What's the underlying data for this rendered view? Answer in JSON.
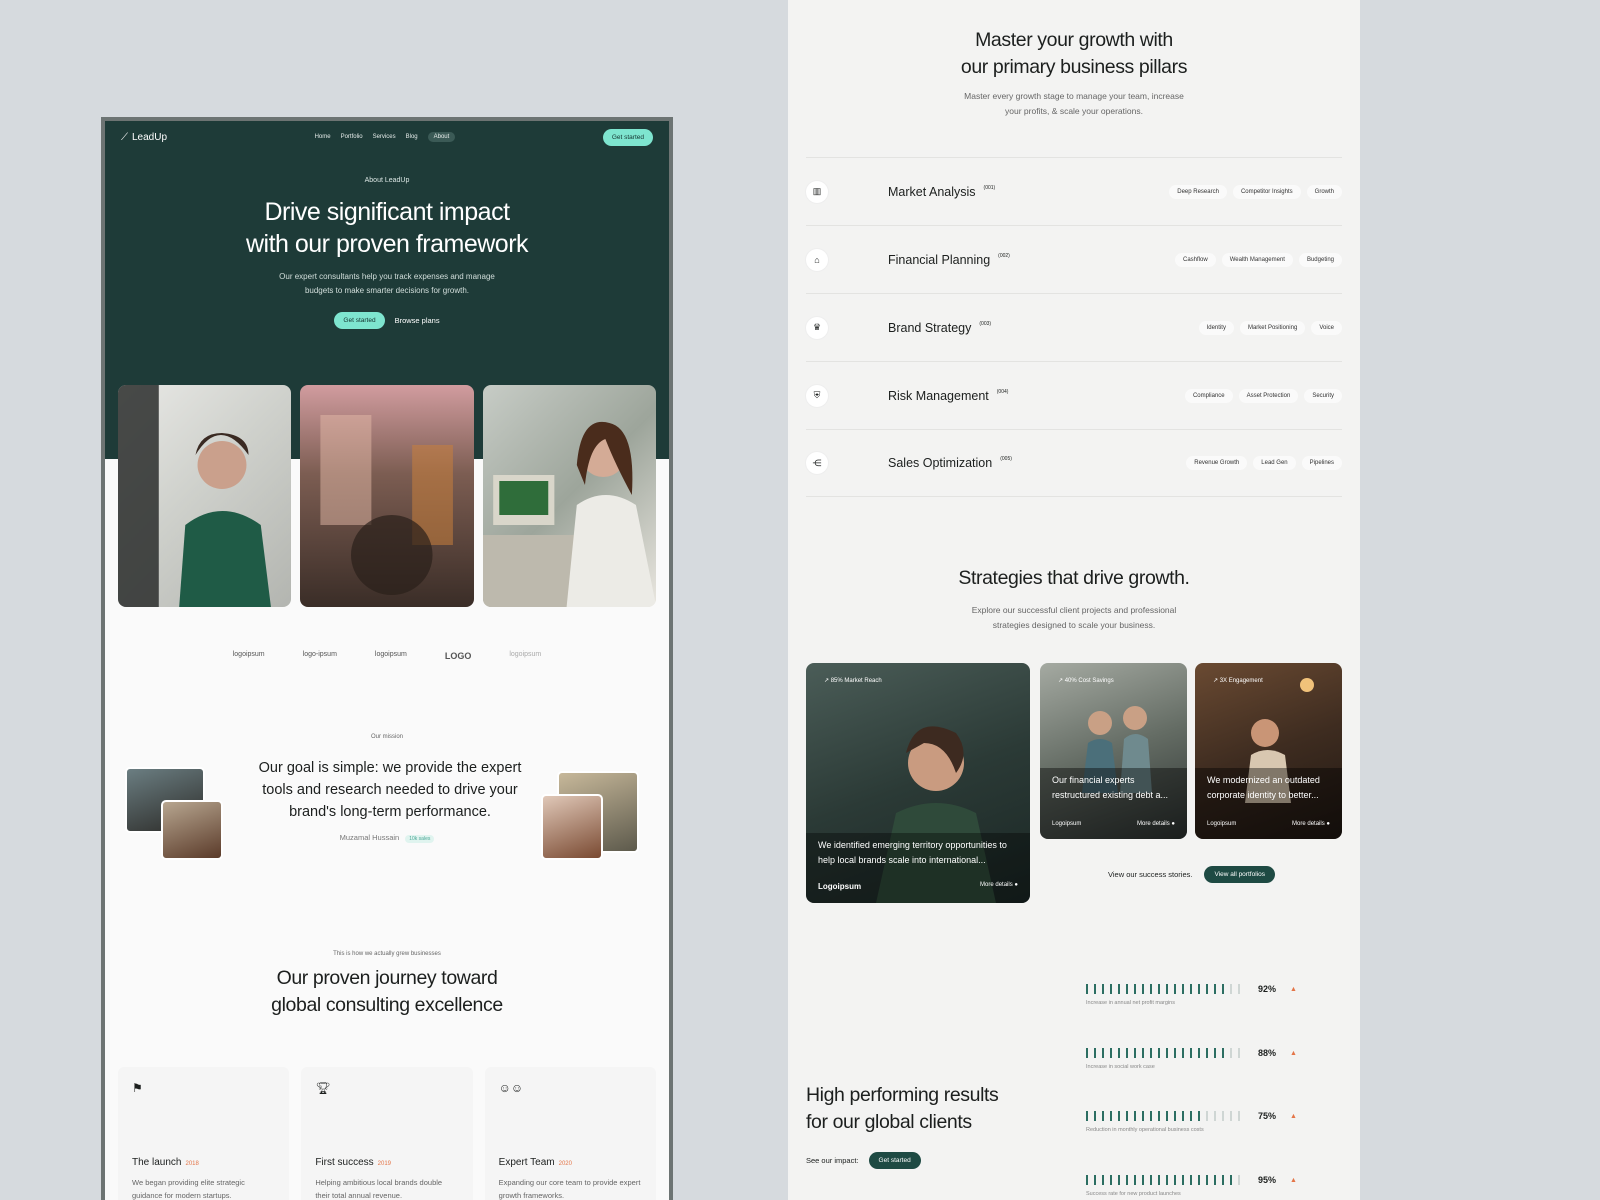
{
  "left": {
    "nav": {
      "logo": "LeadUp",
      "links": [
        "Home",
        "Portfolio",
        "Services",
        "Blog",
        "About"
      ],
      "cta": "Get started"
    },
    "hero": {
      "eyebrow": "About LeadUp",
      "title_line1": "Drive significant impact",
      "title_line2": "with our proven framework",
      "subtitle": "Our expert consultants help you track expenses and manage budgets to make smarter decisions for growth.",
      "primary_cta": "Get started",
      "secondary_cta": "Browse plans"
    },
    "logos": [
      "logoipsum",
      "logo-ipsum",
      "logoipsum",
      "LOGO",
      "logoipsum"
    ],
    "mission": {
      "eyebrow": "Our mission",
      "quote": "Our goal is simple: we provide the expert tools and research needed to drive your brand's long-term performance.",
      "author": "Muzamal Hussain",
      "author_tag": "10k sales"
    },
    "journey": {
      "eyebrow": "This is how we actually grew businesses",
      "title_line1": "Our proven journey toward",
      "title_line2": "global consulting excellence"
    },
    "milestones": [
      {
        "icon": "flag-icon",
        "title": "The launch",
        "year": "2018",
        "desc": "We began providing elite strategic guidance for modern startups."
      },
      {
        "icon": "trophy-icon",
        "title": "First success",
        "year": "2019",
        "desc": "Helping ambitious local brands double their total annual revenue."
      },
      {
        "icon": "team-icon",
        "title": "Expert Team",
        "year": "2020",
        "desc": "Expanding our core team to provide expert growth frameworks."
      }
    ]
  },
  "right": {
    "pillars_title_line1": "Master your growth with",
    "pillars_title_line2": "our primary business pillars",
    "pillars_subtitle": "Master every growth stage to manage your team, increase your profits, & scale your operations.",
    "pillars": [
      {
        "name": "Market Analysis",
        "num": "(001)",
        "tags": [
          "Deep Research",
          "Competitor Insights",
          "Growth"
        ]
      },
      {
        "name": "Financial Planning",
        "num": "(002)",
        "tags": [
          "Cashflow",
          "Wealth Management",
          "Budgeting"
        ]
      },
      {
        "name": "Brand Strategy",
        "num": "(003)",
        "tags": [
          "Identity",
          "Market Positioning",
          "Voice"
        ]
      },
      {
        "name": "Risk Management",
        "num": "(004)",
        "tags": [
          "Compliance",
          "Asset Protection",
          "Security"
        ]
      },
      {
        "name": "Sales Optimization",
        "num": "(005)",
        "tags": [
          "Revenue Growth",
          "Lead Gen",
          "Pipelines"
        ]
      }
    ],
    "strategies_title": "Strategies that drive growth.",
    "strategies_subtitle": "Explore our successful client projects and professional strategies designed to scale your business.",
    "projects": [
      {
        "badge": "85% Market Reach",
        "desc": "We identified emerging territory opportunities to help local brands scale into international...",
        "brand": "Logoipsum",
        "more": "More details"
      },
      {
        "badge": "40% Cost Savings",
        "desc": "Our financial experts restructured existing debt a...",
        "brand": "Logoipsum",
        "more": "More details"
      },
      {
        "badge": "3X Engagement",
        "desc": "We modernized an outdated corporate identity to better...",
        "brand": "Logoipsum",
        "more": "More details"
      }
    ],
    "view_text": "View our success stories.",
    "view_button": "View all portfolios",
    "results_title_line1": "High performing results",
    "results_title_line2": "for our global clients",
    "impact_label": "See our impact:",
    "impact_button": "Get started",
    "stats": [
      {
        "pct": "92%",
        "value": 0.92,
        "desc": "Increase in annual net profit margins"
      },
      {
        "pct": "88%",
        "value": 0.88,
        "desc": "Increase in social work case"
      },
      {
        "pct": "75%",
        "value": 0.75,
        "desc": "Reduction in monthly operational business costs"
      },
      {
        "pct": "95%",
        "value": 0.95,
        "desc": "Success rate for new product launches"
      }
    ]
  }
}
